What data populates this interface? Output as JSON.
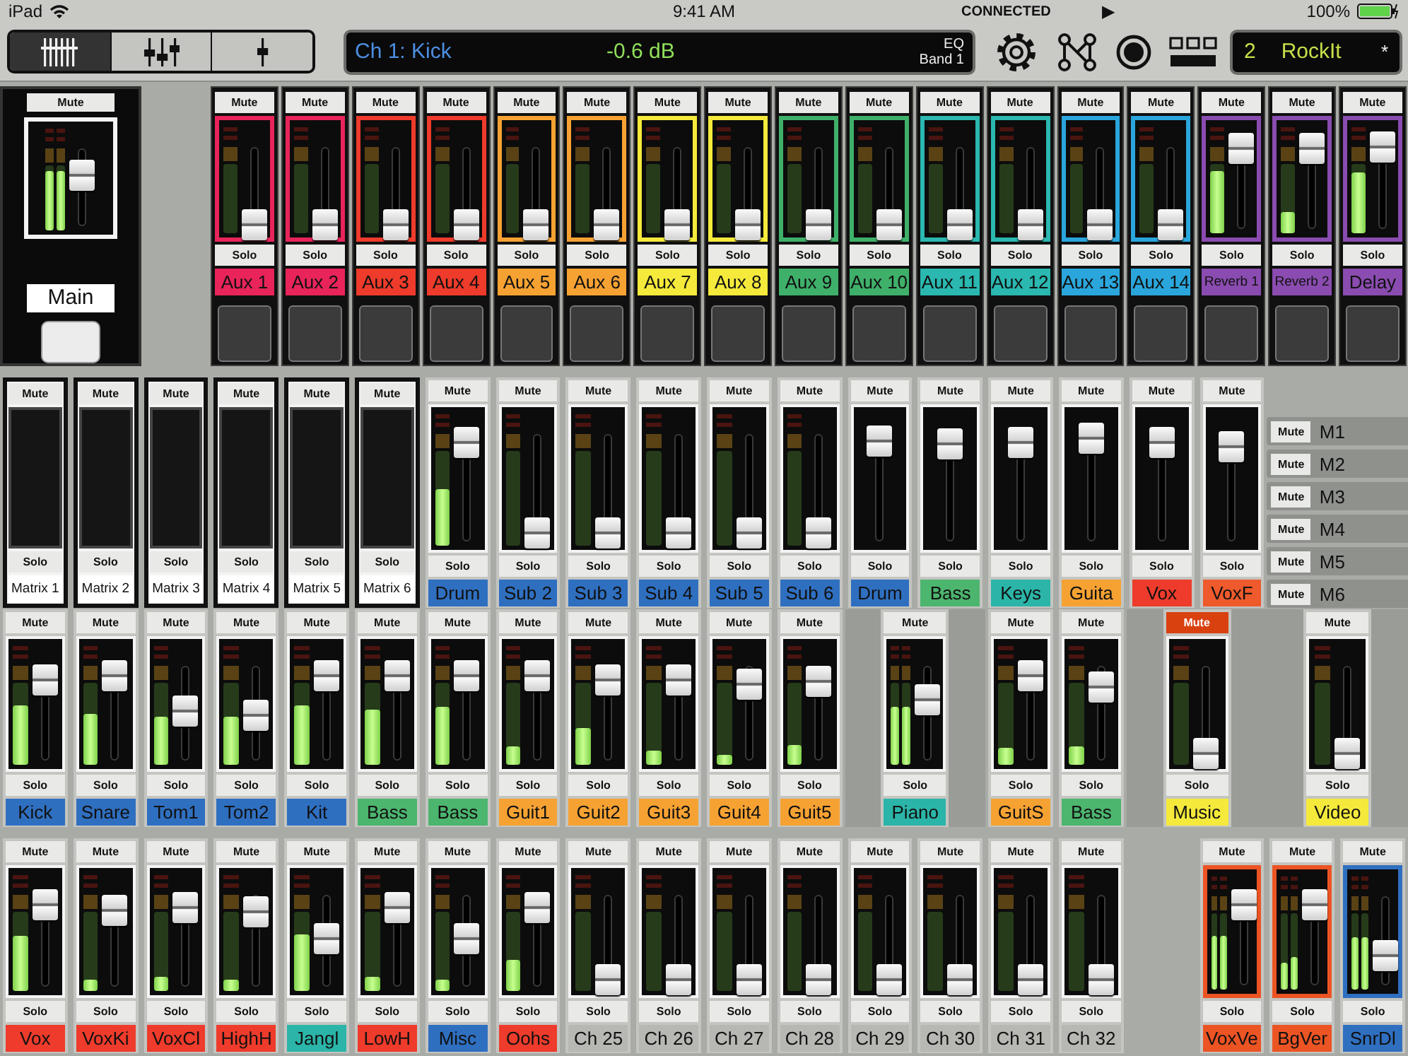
{
  "status_bar": {
    "device": "iPad",
    "time": "9:41 AM",
    "connection": "CONNECTED",
    "transport": "▶",
    "battery": "100%"
  },
  "toolbar": {
    "view_tabs": [
      {
        "kind": "bank",
        "selected": true
      },
      {
        "kind": "mix",
        "selected": false
      },
      {
        "kind": "single",
        "selected": false
      }
    ],
    "display": {
      "channel": "Ch 1: Kick",
      "value": "-0.6 dB",
      "param": "EQ",
      "band": "Band 1"
    },
    "scene": {
      "number": "2",
      "name": "RockIt",
      "modified": "*"
    }
  },
  "main": {
    "mute": "Mute",
    "muted": false,
    "meters": [
      {
        "level": 0.92
      },
      {
        "level": 0.92
      }
    ],
    "fader": {
      "level": 0.55
    },
    "name": "Main"
  },
  "aux_row": {
    "strips": [
      {
        "kind": "aux",
        "name": "Aux 1",
        "color": "#e8245a",
        "framed": true,
        "mute": "Mute",
        "muted": false,
        "solo": "Solo",
        "meters": [
          {
            "level": 0
          }
        ],
        "fader": {
          "level": 0.08
        }
      },
      {
        "kind": "aux",
        "name": "Aux 2",
        "color": "#e8245a",
        "framed": true,
        "mute": "Mute",
        "muted": false,
        "solo": "Solo",
        "meters": [
          {
            "level": 0
          }
        ],
        "fader": {
          "level": 0.08
        }
      },
      {
        "kind": "aux",
        "name": "Aux 3",
        "color": "#ee3b2b",
        "framed": true,
        "mute": "Mute",
        "muted": false,
        "solo": "Solo",
        "meters": [
          {
            "level": 0
          }
        ],
        "fader": {
          "level": 0.08
        }
      },
      {
        "kind": "aux",
        "name": "Aux 4",
        "color": "#ee3b2b",
        "framed": true,
        "mute": "Mute",
        "muted": false,
        "solo": "Solo",
        "meters": [
          {
            "level": 0
          }
        ],
        "fader": {
          "level": 0.08
        }
      },
      {
        "kind": "aux",
        "name": "Aux 5",
        "color": "#f6a233",
        "framed": true,
        "mute": "Mute",
        "muted": false,
        "solo": "Solo",
        "meters": [
          {
            "level": 0
          }
        ],
        "fader": {
          "level": 0.08
        }
      },
      {
        "kind": "aux",
        "name": "Aux 6",
        "color": "#f6a233",
        "framed": true,
        "mute": "Mute",
        "muted": false,
        "solo": "Solo",
        "meters": [
          {
            "level": 0
          }
        ],
        "fader": {
          "level": 0.08
        }
      },
      {
        "kind": "aux",
        "name": "Aux 7",
        "color": "#f5ea3b",
        "framed": true,
        "mute": "Mute",
        "muted": false,
        "solo": "Solo",
        "meters": [
          {
            "level": 0
          }
        ],
        "fader": {
          "level": 0.08
        }
      },
      {
        "kind": "aux",
        "name": "Aux 8",
        "color": "#f5ea3b",
        "framed": true,
        "mute": "Mute",
        "muted": false,
        "solo": "Solo",
        "meters": [
          {
            "level": 0
          }
        ],
        "fader": {
          "level": 0.08
        }
      },
      {
        "kind": "aux",
        "name": "Aux 9",
        "color": "#3fb06a",
        "framed": true,
        "mute": "Mute",
        "muted": false,
        "solo": "Solo",
        "meters": [
          {
            "level": 0
          }
        ],
        "fader": {
          "level": 0.08
        }
      },
      {
        "kind": "aux",
        "name": "Aux 10",
        "color": "#3fb06a",
        "framed": true,
        "mute": "Mute",
        "muted": false,
        "solo": "Solo",
        "meters": [
          {
            "level": 0
          }
        ],
        "fader": {
          "level": 0.08
        }
      },
      {
        "kind": "aux",
        "name": "Aux 11",
        "color": "#2ab8b0",
        "framed": true,
        "mute": "Mute",
        "muted": false,
        "solo": "Solo",
        "meters": [
          {
            "level": 0
          }
        ],
        "fader": {
          "level": 0.08
        }
      },
      {
        "kind": "aux",
        "name": "Aux 12",
        "color": "#2ab8b0",
        "framed": true,
        "mute": "Mute",
        "muted": false,
        "solo": "Solo",
        "meters": [
          {
            "level": 0
          }
        ],
        "fader": {
          "level": 0.08
        }
      },
      {
        "kind": "aux",
        "name": "Aux 13",
        "color": "#2aa6dc",
        "framed": true,
        "mute": "Mute",
        "muted": false,
        "solo": "Solo",
        "meters": [
          {
            "level": 0
          }
        ],
        "fader": {
          "level": 0.08
        }
      },
      {
        "kind": "aux",
        "name": "Aux 14",
        "color": "#2aa6dc",
        "framed": true,
        "mute": "Mute",
        "muted": false,
        "solo": "Solo",
        "meters": [
          {
            "level": 0
          }
        ],
        "fader": {
          "level": 0.08
        }
      },
      {
        "kind": "aux",
        "name": "Reverb 1",
        "color": "#8a4cb0",
        "framed": true,
        "mute": "Mute",
        "muted": false,
        "solo": "Solo",
        "meters": [
          {
            "level": 0.9
          }
        ],
        "fader": {
          "level": 0.8
        }
      },
      {
        "kind": "aux",
        "name": "Reverb 2",
        "color": "#8a4cb0",
        "framed": true,
        "mute": "Mute",
        "muted": false,
        "solo": "Solo",
        "meters": [
          {
            "level": 0.3
          }
        ],
        "fader": {
          "level": 0.8
        }
      },
      {
        "kind": "aux",
        "name": "Delay",
        "color": "#8a4cb0",
        "framed": true,
        "mute": "Mute",
        "muted": false,
        "solo": "Solo",
        "meters": [
          {
            "level": 0.88
          }
        ],
        "fader": {
          "level": 0.82
        }
      }
    ]
  },
  "rows": [
    {
      "strips": [
        {
          "kind": "matrix",
          "name": "Matrix 1",
          "color": "#ffffff",
          "mute": "Mute",
          "muted": false,
          "solo": "Solo"
        },
        {
          "kind": "matrix",
          "name": "Matrix 2",
          "color": "#ffffff",
          "mute": "Mute",
          "muted": false,
          "solo": "Solo"
        },
        {
          "kind": "matrix",
          "name": "Matrix 3",
          "color": "#ffffff",
          "mute": "Mute",
          "muted": false,
          "solo": "Solo"
        },
        {
          "kind": "matrix",
          "name": "Matrix 4",
          "color": "#ffffff",
          "mute": "Mute",
          "muted": false,
          "solo": "Solo"
        },
        {
          "kind": "matrix",
          "name": "Matrix 5",
          "color": "#ffffff",
          "mute": "Mute",
          "muted": false,
          "solo": "Solo"
        },
        {
          "kind": "matrix",
          "name": "Matrix 6",
          "color": "#ffffff",
          "mute": "Mute",
          "muted": false,
          "solo": "Solo"
        },
        {
          "kind": "channel",
          "name": "Drum",
          "color": "#2f6fc0",
          "framed": false,
          "mute": "Mute",
          "muted": false,
          "solo": "Solo",
          "meters": [
            {
              "level": 0.6
            }
          ],
          "fader": {
            "level": 0.78
          }
        },
        {
          "kind": "channel",
          "name": "Sub 2",
          "color": "#2f6fc0",
          "framed": false,
          "mute": "Mute",
          "muted": false,
          "solo": "Solo",
          "meters": [
            {
              "level": 0
            }
          ],
          "fader": {
            "level": 0.1
          }
        },
        {
          "kind": "channel",
          "name": "Sub 3",
          "color": "#2f6fc0",
          "framed": false,
          "mute": "Mute",
          "muted": false,
          "solo": "Solo",
          "meters": [
            {
              "level": 0
            }
          ],
          "fader": {
            "level": 0.1
          }
        },
        {
          "kind": "channel",
          "name": "Sub 4",
          "color": "#2f6fc0",
          "framed": false,
          "mute": "Mute",
          "muted": false,
          "solo": "Solo",
          "meters": [
            {
              "level": 0
            }
          ],
          "fader": {
            "level": 0.1
          }
        },
        {
          "kind": "channel",
          "name": "Sub 5",
          "color": "#2f6fc0",
          "framed": false,
          "mute": "Mute",
          "muted": false,
          "solo": "Solo",
          "meters": [
            {
              "level": 0
            }
          ],
          "fader": {
            "level": 0.1
          }
        },
        {
          "kind": "channel",
          "name": "Sub 6",
          "color": "#2f6fc0",
          "framed": false,
          "mute": "Mute",
          "muted": false,
          "solo": "Solo",
          "meters": [
            {
              "level": 0
            }
          ],
          "fader": {
            "level": 0.1
          }
        },
        {
          "kind": "dca",
          "name": "Drum",
          "color": "#2f6fc0",
          "mute": "Mute",
          "muted": false,
          "solo": "Solo",
          "fader": {
            "level": 0.8
          }
        },
        {
          "kind": "dca",
          "name": "Bass",
          "color": "#4cb56e",
          "mute": "Mute",
          "muted": false,
          "solo": "Solo",
          "fader": {
            "level": 0.77
          }
        },
        {
          "kind": "dca",
          "name": "Keys",
          "color": "#2bb5a8",
          "mute": "Mute",
          "muted": false,
          "solo": "Solo",
          "fader": {
            "level": 0.78
          }
        },
        {
          "kind": "dca",
          "name": "Guita",
          "color": "#f6a233",
          "mute": "Mute",
          "muted": false,
          "solo": "Solo",
          "fader": {
            "level": 0.82
          }
        },
        {
          "kind": "dca",
          "name": "Vox",
          "color": "#ee3b2b",
          "mute": "Mute",
          "muted": false,
          "solo": "Solo",
          "fader": {
            "level": 0.78
          }
        },
        {
          "kind": "dca",
          "name": "VoxF",
          "color": "#ee5a2b",
          "mute": "Mute",
          "muted": false,
          "solo": "Solo",
          "fader": {
            "level": 0.75
          }
        }
      ]
    },
    {
      "strips": [
        {
          "kind": "channel",
          "name": "Kick",
          "color": "#2f6fc0",
          "framed": false,
          "mute": "Mute",
          "muted": false,
          "solo": "Solo",
          "meters": [
            {
              "level": 0.72
            }
          ],
          "fader": {
            "level": 0.72
          }
        },
        {
          "kind": "channel",
          "name": "Snare",
          "color": "#2f6fc0",
          "framed": false,
          "mute": "Mute",
          "muted": false,
          "solo": "Solo",
          "meters": [
            {
              "level": 0.62
            }
          ],
          "fader": {
            "level": 0.75
          }
        },
        {
          "kind": "channel",
          "name": "Tom1",
          "color": "#2f6fc0",
          "framed": false,
          "mute": "Mute",
          "muted": false,
          "solo": "Solo",
          "meters": [
            {
              "level": 0.58
            }
          ],
          "fader": {
            "level": 0.45
          }
        },
        {
          "kind": "channel",
          "name": "Tom2",
          "color": "#2f6fc0",
          "framed": false,
          "mute": "Mute",
          "muted": false,
          "solo": "Solo",
          "meters": [
            {
              "level": 0.58
            }
          ],
          "fader": {
            "level": 0.42
          }
        },
        {
          "kind": "channel",
          "name": "Kit",
          "color": "#2f6fc0",
          "framed": false,
          "mute": "Mute",
          "muted": false,
          "solo": "Solo",
          "meters": [
            {
              "level": 0.72
            }
          ],
          "fader": {
            "level": 0.75
          }
        },
        {
          "kind": "channel",
          "name": "Bass",
          "color": "#4cb56e",
          "framed": false,
          "mute": "Mute",
          "muted": false,
          "solo": "Solo",
          "meters": [
            {
              "level": 0.68
            }
          ],
          "fader": {
            "level": 0.75
          }
        },
        {
          "kind": "channel",
          "name": "Bass",
          "color": "#4cb56e",
          "framed": false,
          "mute": "Mute",
          "muted": false,
          "solo": "Solo",
          "meters": [
            {
              "level": 0.7
            }
          ],
          "fader": {
            "level": 0.75
          }
        },
        {
          "kind": "channel",
          "name": "Guit1",
          "color": "#f6a233",
          "framed": false,
          "mute": "Mute",
          "muted": false,
          "solo": "Solo",
          "meters": [
            {
              "level": 0.22
            }
          ],
          "fader": {
            "level": 0.75
          }
        },
        {
          "kind": "channel",
          "name": "Guit2",
          "color": "#f6a233",
          "framed": false,
          "mute": "Mute",
          "muted": false,
          "solo": "Solo",
          "meters": [
            {
              "level": 0.45
            }
          ],
          "fader": {
            "level": 0.72
          }
        },
        {
          "kind": "channel",
          "name": "Guit3",
          "color": "#f6a233",
          "framed": false,
          "mute": "Mute",
          "muted": false,
          "solo": "Solo",
          "meters": [
            {
              "level": 0.18
            }
          ],
          "fader": {
            "level": 0.72
          }
        },
        {
          "kind": "channel",
          "name": "Guit4",
          "color": "#f6a233",
          "framed": false,
          "mute": "Mute",
          "muted": false,
          "solo": "Solo",
          "meters": [
            {
              "level": 0.12
            }
          ],
          "fader": {
            "level": 0.68
          }
        },
        {
          "kind": "channel",
          "name": "Guit5",
          "color": "#f6a233",
          "framed": false,
          "mute": "Mute",
          "muted": false,
          "solo": "Solo",
          "meters": [
            {
              "level": 0.24
            }
          ],
          "fader": {
            "level": 0.7
          }
        },
        {
          "kind": "wide",
          "name": "Piano",
          "color": "#2bb5a8",
          "framed": false,
          "mute": "Mute",
          "muted": false,
          "solo": "Solo",
          "meters": [
            {
              "level": 0.7
            },
            {
              "level": 0.7
            }
          ],
          "fader": {
            "level": 0.55
          }
        },
        {
          "kind": "channel",
          "name": "GuitS",
          "color": "#f6a233",
          "framed": false,
          "mute": "Mute",
          "muted": false,
          "solo": "Solo",
          "meters": [
            {
              "level": 0.2
            }
          ],
          "fader": {
            "level": 0.75
          }
        },
        {
          "kind": "channel",
          "name": "Bass",
          "color": "#4cb56e",
          "framed": false,
          "mute": "Mute",
          "muted": false,
          "solo": "Solo",
          "meters": [
            {
              "level": 0.22
            }
          ],
          "fader": {
            "level": 0.66
          }
        },
        {
          "kind": "wide",
          "name": "Music",
          "color": "#f5ea3b",
          "framed": false,
          "mute": "Mute",
          "muted": true,
          "solo": "Solo",
          "meters": [
            {
              "level": 0
            }
          ],
          "fader": {
            "level": 0.1
          }
        },
        {
          "kind": "wide",
          "name": "Video",
          "color": "#f5ea3b",
          "framed": false,
          "mute": "Mute",
          "muted": false,
          "solo": "Solo",
          "meters": [
            {
              "level": 0
            }
          ],
          "fader": {
            "level": 0.1
          }
        }
      ]
    },
    {
      "strips": [
        {
          "kind": "channel",
          "name": "Vox",
          "color": "#ee3b2b",
          "framed": false,
          "mute": "Mute",
          "muted": false,
          "solo": "Solo",
          "meters": [
            {
              "level": 0.7
            }
          ],
          "fader": {
            "level": 0.75
          }
        },
        {
          "kind": "channel",
          "name": "VoxKi",
          "color": "#ee3b2b",
          "framed": false,
          "mute": "Mute",
          "muted": false,
          "solo": "Solo",
          "meters": [
            {
              "level": 0.15
            }
          ],
          "fader": {
            "level": 0.7
          }
        },
        {
          "kind": "channel",
          "name": "VoxCl",
          "color": "#ee3b2b",
          "framed": false,
          "mute": "Mute",
          "muted": false,
          "solo": "Solo",
          "meters": [
            {
              "level": 0.18
            }
          ],
          "fader": {
            "level": 0.72
          }
        },
        {
          "kind": "channel",
          "name": "HighH",
          "color": "#ee3b2b",
          "framed": false,
          "mute": "Mute",
          "muted": false,
          "solo": "Solo",
          "meters": [
            {
              "level": 0.15
            }
          ],
          "fader": {
            "level": 0.68
          }
        },
        {
          "kind": "channel",
          "name": "Jangl",
          "color": "#2bb5a8",
          "framed": false,
          "mute": "Mute",
          "muted": false,
          "solo": "Solo",
          "meters": [
            {
              "level": 0.72
            }
          ],
          "fader": {
            "level": 0.45
          }
        },
        {
          "kind": "channel",
          "name": "LowH",
          "color": "#ee3b2b",
          "framed": false,
          "mute": "Mute",
          "muted": false,
          "solo": "Solo",
          "meters": [
            {
              "level": 0.17
            }
          ],
          "fader": {
            "level": 0.72
          }
        },
        {
          "kind": "channel",
          "name": "Misc",
          "color": "#2f6fc0",
          "framed": false,
          "mute": "Mute",
          "muted": false,
          "solo": "Solo",
          "meters": [
            {
              "level": 0.14
            }
          ],
          "fader": {
            "level": 0.45
          }
        },
        {
          "kind": "channel",
          "name": "Oohs",
          "color": "#ee3b2b",
          "framed": false,
          "mute": "Mute",
          "muted": false,
          "solo": "Solo",
          "meters": [
            {
              "level": 0.4
            }
          ],
          "fader": {
            "level": 0.72
          }
        },
        {
          "kind": "channel",
          "name": "Ch 25",
          "color": "#b7b8b3",
          "framed": false,
          "mute": "Mute",
          "muted": false,
          "solo": "Solo",
          "meters": [
            {
              "level": 0
            }
          ],
          "fader": {
            "level": 0.1
          }
        },
        {
          "kind": "channel",
          "name": "Ch 26",
          "color": "#b7b8b3",
          "framed": false,
          "mute": "Mute",
          "muted": false,
          "solo": "Solo",
          "meters": [
            {
              "level": 0
            }
          ],
          "fader": {
            "level": 0.1
          }
        },
        {
          "kind": "channel",
          "name": "Ch 27",
          "color": "#b7b8b3",
          "framed": false,
          "mute": "Mute",
          "muted": false,
          "solo": "Solo",
          "meters": [
            {
              "level": 0
            }
          ],
          "fader": {
            "level": 0.1
          }
        },
        {
          "kind": "channel",
          "name": "Ch 28",
          "color": "#b7b8b3",
          "framed": false,
          "mute": "Mute",
          "muted": false,
          "solo": "Solo",
          "meters": [
            {
              "level": 0
            }
          ],
          "fader": {
            "level": 0.1
          }
        },
        {
          "kind": "channel",
          "name": "Ch 29",
          "color": "#b7b8b3",
          "framed": false,
          "mute": "Mute",
          "muted": false,
          "solo": "Solo",
          "meters": [
            {
              "level": 0
            }
          ],
          "fader": {
            "level": 0.1
          }
        },
        {
          "kind": "channel",
          "name": "Ch 30",
          "color": "#b7b8b3",
          "framed": false,
          "mute": "Mute",
          "muted": false,
          "solo": "Solo",
          "meters": [
            {
              "level": 0
            }
          ],
          "fader": {
            "level": 0.1
          }
        },
        {
          "kind": "channel",
          "name": "Ch 31",
          "color": "#b7b8b3",
          "framed": false,
          "mute": "Mute",
          "muted": false,
          "solo": "Solo",
          "meters": [
            {
              "level": 0
            }
          ],
          "fader": {
            "level": 0.1
          }
        },
        {
          "kind": "channel",
          "name": "Ch 32",
          "color": "#b7b8b3",
          "framed": false,
          "mute": "Mute",
          "muted": false,
          "solo": "Solo",
          "meters": [
            {
              "level": 0
            }
          ],
          "fader": {
            "level": 0.1
          }
        },
        {
          "kind": "empty"
        },
        {
          "kind": "channel",
          "name": "VoxVe",
          "color": "#ec5424",
          "framed": true,
          "mute": "Mute",
          "muted": false,
          "solo": "Solo",
          "meters": [
            {
              "level": 0.7
            },
            {
              "level": 0.7
            }
          ],
          "fader": {
            "level": 0.75
          }
        },
        {
          "kind": "channel",
          "name": "BgVer",
          "color": "#ec5424",
          "framed": true,
          "mute": "Mute",
          "muted": false,
          "solo": "Solo",
          "meters": [
            {
              "level": 0.35
            },
            {
              "level": 0.42
            }
          ],
          "fader": {
            "level": 0.75
          }
        },
        {
          "kind": "channel",
          "name": "SnrDl",
          "color": "#2f6fc0",
          "framed": true,
          "mute": "Mute",
          "muted": false,
          "solo": "Solo",
          "meters": [
            {
              "level": 0.68
            },
            {
              "level": 0.68
            }
          ],
          "fader": {
            "level": 0.3
          }
        }
      ]
    }
  ],
  "mute_groups": [
    {
      "mute": "Mute",
      "muted": false,
      "name": "M1"
    },
    {
      "mute": "Mute",
      "muted": false,
      "name": "M2"
    },
    {
      "mute": "Mute",
      "muted": false,
      "name": "M3"
    },
    {
      "mute": "Mute",
      "muted": false,
      "name": "M4"
    },
    {
      "mute": "Mute",
      "muted": false,
      "name": "M5"
    },
    {
      "mute": "Mute",
      "muted": false,
      "name": "M6"
    }
  ]
}
